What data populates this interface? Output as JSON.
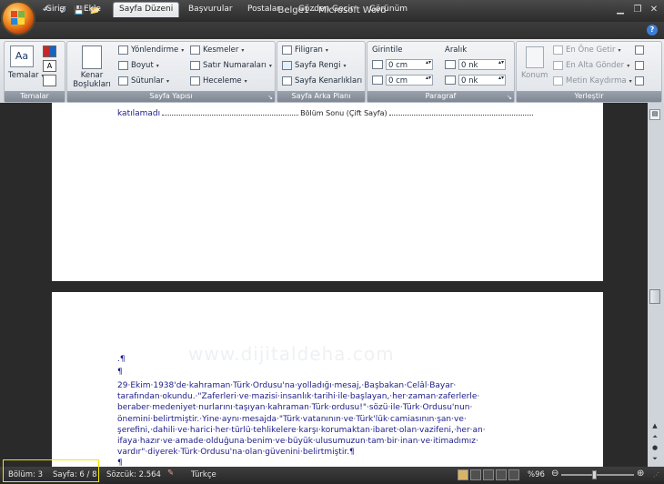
{
  "window": {
    "title": "Belge1 - Microsoft Word"
  },
  "qat": {
    "undo": "↶",
    "redo": "↺",
    "save": "💾",
    "open": "📂"
  },
  "tabs": [
    "Giriş",
    "Ekle",
    "Sayfa Düzeni",
    "Başvurular",
    "Postalar",
    "Gözden Geçir",
    "Görünüm"
  ],
  "active_tab": "Sayfa Düzeni",
  "ribbon": {
    "temalar": {
      "label": "Temalar",
      "button": "Temalar"
    },
    "sayfa_yapisi": {
      "label": "Sayfa Yapısı",
      "margins": "Kenar Boşlukları",
      "orientation": "Yönlendirme",
      "size": "Boyut",
      "columns": "Sütunlar",
      "breaks": "Kesmeler",
      "line_numbers": "Satır Numaraları",
      "hyphenation": "Heceleme"
    },
    "sayfa_arka_plani": {
      "label": "Sayfa Arka Planı",
      "watermark": "Filigran",
      "page_color": "Sayfa Rengi",
      "page_borders": "Sayfa Kenarlıkları"
    },
    "paragraf": {
      "label": "Paragraf",
      "indent_title": "Girintile",
      "spacing_title": "Aralık",
      "indent_left": "0 cm",
      "indent_right": "0 cm",
      "space_before": "0 nk",
      "space_after": "0 nk"
    },
    "yerlestir": {
      "label": "Yerleştir",
      "position": "Konum",
      "bring_front": "En Öne Getir",
      "send_back": "En Alta Gönder",
      "text_wrap": "Metin Kaydırma"
    }
  },
  "document": {
    "page1_line": "katılamadı",
    "section_break": "Bölüm Sonu (Çift Sayfa)",
    "mark1": ".¶",
    "mark2": "¶",
    "paragraph_lines": [
      "29·Ekim·1938'de·kahraman·Türk·Ordusu'na·yolladığı·mesaj,·Başbakan·Celâl·Bayar·",
      "tarafından·okundu.·\"Zaferleri·ve·mazisi·insanlık·tarihi·ile·başlayan,·her·zaman·zaferlerle·",
      "beraber·medeniyet·nurlarını·taşıyan·kahraman·Türk·ordusu!\"·sözü·ile·Türk·Ordusu'nun·",
      "önemini·belirtmiştir.·Yine·aynı·mesajda·\"Türk·vatanının·ve·Türk'lük·camiasının·şan·ve·",
      "şerefini,·dahili·ve·harici·her·türlü·tehlikelere·karşı·korumaktan·ibaret·olan·vazifeni,·her·an·",
      "ifaya·hazır·ve·amade·olduğuna·benim·ve·büyük·ulusumuzun·tam·bir·inan·ve·itimadımız·",
      "vardır\"·diyerek·Türk·Ordusu'na·olan·güvenini·belirtmiştir.¶"
    ],
    "mark3": "¶"
  },
  "status": {
    "section": "Bölüm: 3",
    "page": "Sayfa: 6 / 8",
    "words": "Sözcük: 2.564",
    "language": "Türkçe",
    "zoom": "%96",
    "zoom_level": 0.45
  }
}
